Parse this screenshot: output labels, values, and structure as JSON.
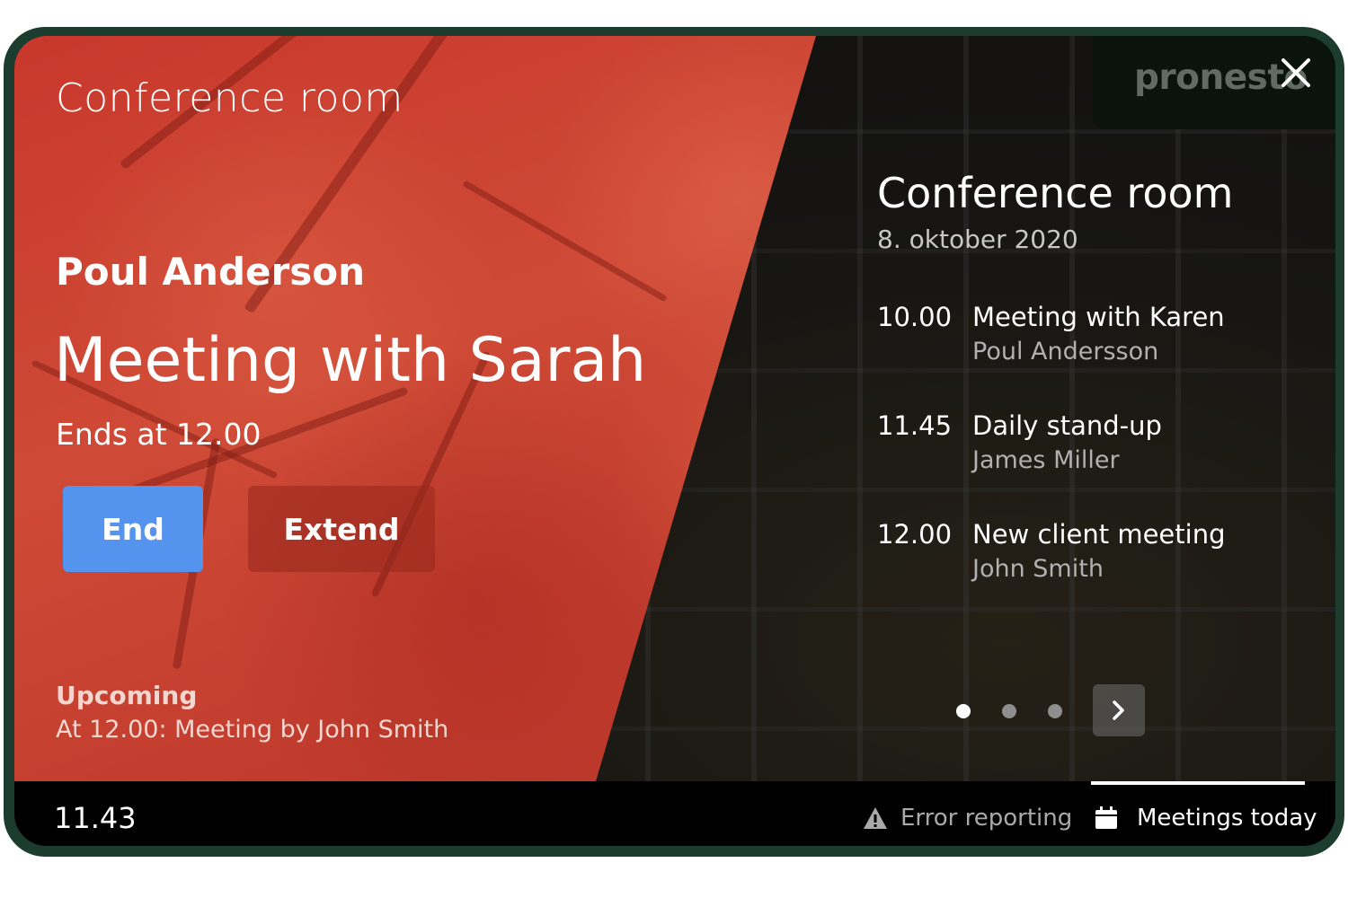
{
  "current_meeting": {
    "room_name": "Conference room",
    "organizer": "Poul Anderson",
    "title": "Meeting with Sarah",
    "ends_text": "Ends at 12.00",
    "status_color": "#c8382c",
    "buttons": {
      "end": "End",
      "extend": "Extend"
    },
    "upcoming_label": "Upcoming",
    "upcoming_text": "At 12.00: Meeting by John Smith"
  },
  "brand": {
    "logo_text": "pronesto",
    "close_icon": "close-icon"
  },
  "schedule": {
    "room_name": "Conference room",
    "date": "8. oktober 2020",
    "items": [
      {
        "time": "10.00",
        "title": "Meeting with Karen",
        "organizer": "Poul Andersson"
      },
      {
        "time": "11.45",
        "title": "Daily stand-up",
        "organizer": "James Miller"
      },
      {
        "time": "12.00",
        "title": "New client meeting",
        "organizer": "John Smith"
      }
    ],
    "pagination": {
      "pages": 3,
      "current": 1,
      "next_icon": "chevron-right-icon"
    }
  },
  "footer": {
    "clock": "11.43",
    "error_reporting": {
      "label": "Error reporting",
      "icon": "warning-icon"
    },
    "meetings_today": {
      "label": "Meetings today",
      "icon": "calendar-icon",
      "active": true
    }
  },
  "colors": {
    "accent": "#5494ee",
    "frame": "#1c3c30",
    "bar": "#000000"
  }
}
